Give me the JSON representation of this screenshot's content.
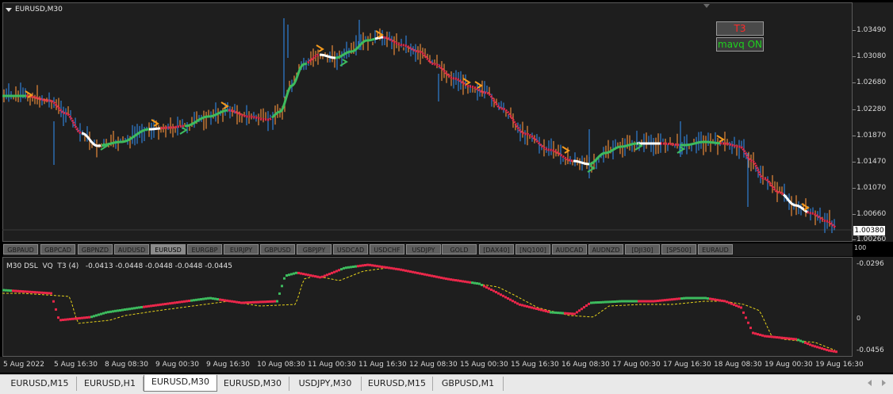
{
  "chart_title": "EURUSD,M30",
  "indicator_buttons": {
    "t3": "T3",
    "mavq": "mavq ON"
  },
  "price_axis": [
    "1.03490",
    "1.03080",
    "1.02680",
    "1.02280",
    "1.01870",
    "1.01470",
    "1.01070",
    "1.00660",
    "1.00260"
  ],
  "current_price": "1.00380",
  "symbols": [
    "GBPAUD",
    "GBPCAD",
    "GBPNZD",
    "AUDUSD",
    "EURUSD",
    "EURGBP",
    "EURJPY",
    "GBPUSD",
    "GBPJPY",
    "USDCAD",
    "USDCHF",
    "USDJPY",
    "GOLD",
    "[DAX40]",
    "[NQ100]",
    "AUDCAD",
    "AUDNZD",
    "[DJI30]",
    "[SP500]",
    "EURAUD"
  ],
  "active_symbol": "EURUSD",
  "subwindow": {
    "title": "M30 DSL  VQ  T3 (4)   -0.0413 -0.0448 -0.0448 -0.0448 -0.0445",
    "axis_top": "-0.0296",
    "axis_bottom": "-0.0456",
    "axis_100": "100",
    "axis_0": "0"
  },
  "time_axis": [
    "5 Aug 2022",
    "5 Aug 16:30",
    "8 Aug 08:30",
    "9 Aug 00:30",
    "9 Aug 16:30",
    "10 Aug 08:30",
    "11 Aug 00:30",
    "11 Aug 16:30",
    "12 Aug 08:30",
    "15 Aug 00:30",
    "15 Aug 16:30",
    "16 Aug 08:30",
    "17 Aug 00:30",
    "17 Aug 16:30",
    "18 Aug 08:30",
    "19 Aug 00:30",
    "19 Aug 16:30"
  ],
  "tabs": [
    "EURUSD,M15",
    "EURUSD,H1",
    "EURUSD,M30",
    "EURUSD,M30",
    "USDJPY,M30",
    "EURUSD,M15",
    "GBPUSD,M1"
  ],
  "active_tab_index": 2,
  "colors": {
    "bull": "#2f7fd4",
    "bear": "#e88a3a",
    "t3_red": "#e8274a",
    "t3_green": "#3dbb5e",
    "t3_white": "#ffffff",
    "arrow_orange": "#f59a1c",
    "signal_yellow": "#e5d21a"
  }
}
